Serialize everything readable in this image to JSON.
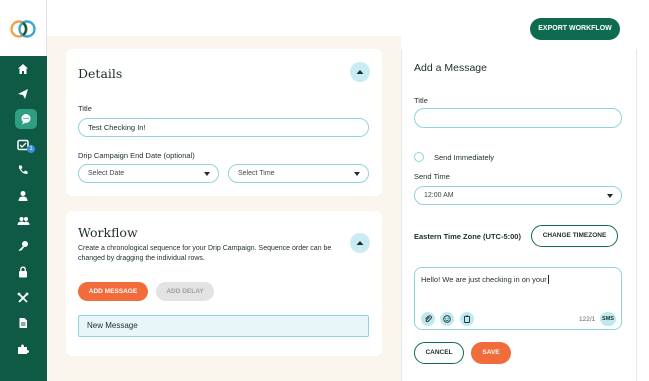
{
  "header": {
    "export_label": "EXPORT WORKFLOW"
  },
  "sidebar": {
    "items": [
      {
        "icon": "home-icon"
      },
      {
        "icon": "send-icon"
      },
      {
        "icon": "chat-icon",
        "active": true
      },
      {
        "icon": "inbox-icon",
        "badge": "1"
      },
      {
        "icon": "phone-icon"
      },
      {
        "icon": "user-icon"
      },
      {
        "icon": "users-icon"
      },
      {
        "icon": "key-icon"
      },
      {
        "icon": "lock-icon"
      },
      {
        "icon": "tools-icon"
      },
      {
        "icon": "document-icon"
      },
      {
        "icon": "puzzle-icon"
      }
    ]
  },
  "details": {
    "title": "Details",
    "title_label": "Title",
    "title_value": "Test Checking In!",
    "end_date_label": "Drip Campaign End Date (optional)",
    "date_placeholder": "Select Date",
    "time_placeholder": "Select Time"
  },
  "workflow": {
    "title": "Workflow",
    "description": "Create a chronological sequence for your Drip Campaign. Sequence order can be changed by dragging the individual rows.",
    "add_message_label": "ADD MESSAGE",
    "add_delay_label": "ADD DELAY",
    "row_label": "New Message"
  },
  "message_panel": {
    "title": "Add a Message",
    "title_label": "Title",
    "title_value": "",
    "send_immediately_label": "Send Immediately",
    "send_time_label": "Send Time",
    "send_time_value": "12:00 AM",
    "timezone_label": "Eastern Time Zone (UTC-5:00)",
    "change_timezone_label": "CHANGE TIMEZONE",
    "message_text": "Hello! We are just checking in on your",
    "char_count": "122/1",
    "sms_label": "SMS",
    "cancel_label": "CANCEL",
    "save_label": "SAVE"
  },
  "colors": {
    "brand_dark": "#0f5a44",
    "brand_button": "#0f6b4f",
    "accent_orange": "#f26b3a",
    "input_border": "#8fd3dc",
    "collapse_bg": "#c9ecf3",
    "page_bg": "#faf6ee"
  }
}
